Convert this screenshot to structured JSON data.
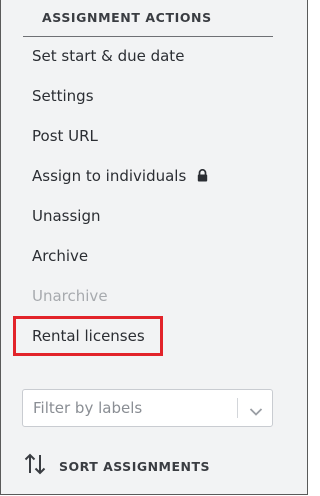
{
  "section": {
    "title": "ASSIGNMENT ACTIONS"
  },
  "menu": {
    "set_dates": "Set start & due date",
    "settings": "Settings",
    "post_url": "Post URL",
    "assign_individuals": "Assign to individuals",
    "unassign": "Unassign",
    "archive": "Archive",
    "unarchive": "Unarchive",
    "rental_licenses": "Rental licenses"
  },
  "filter": {
    "placeholder": "Filter by labels",
    "value": ""
  },
  "sort": {
    "label": "SORT ASSIGNMENTS"
  },
  "icons": {
    "lock": "lock-icon",
    "chevron": "chevron-down-icon",
    "sort": "sort-arrows-icon"
  },
  "colors": {
    "highlight": "#e2232a",
    "disabled_text": "#a7aaae",
    "panel_bg": "#f2f3f4"
  }
}
